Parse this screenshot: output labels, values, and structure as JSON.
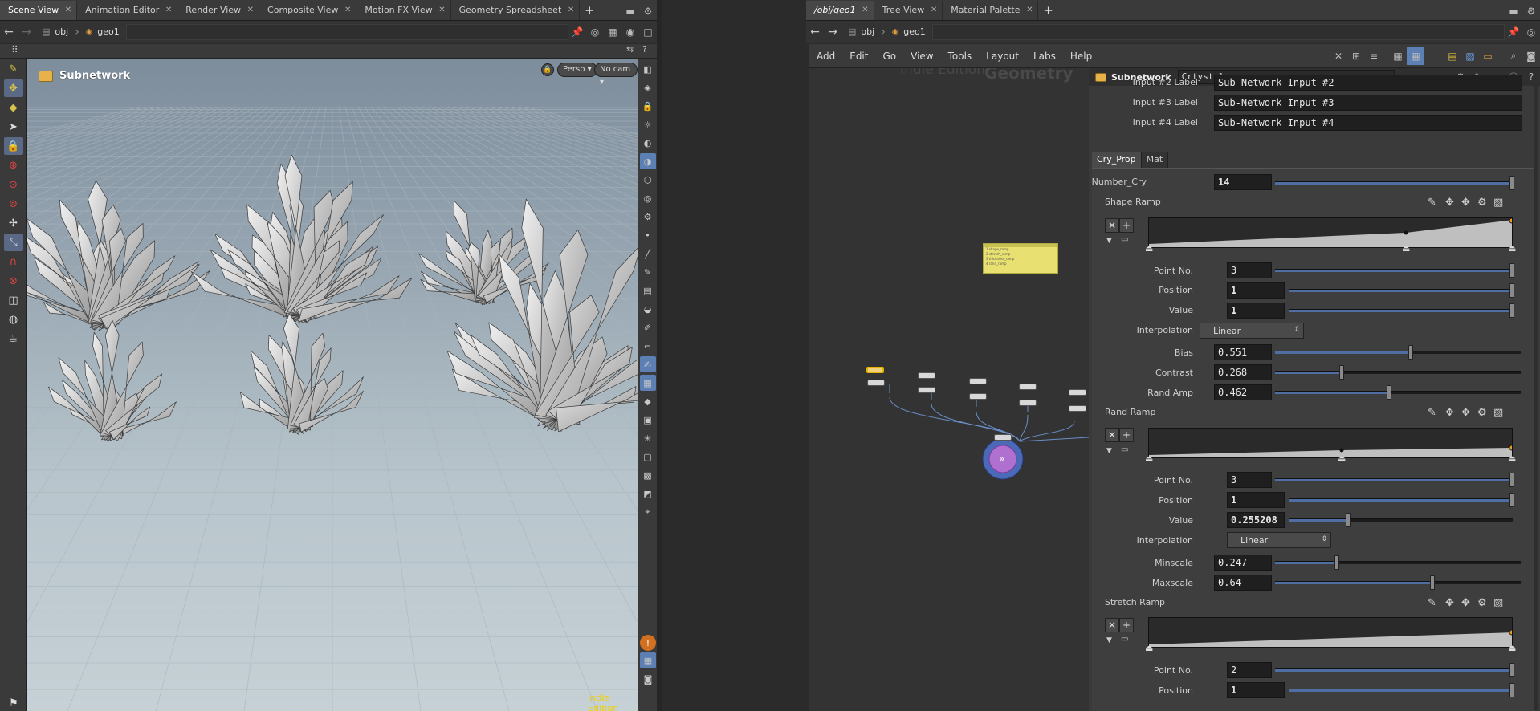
{
  "left_tabs": [
    {
      "label": "Scene View"
    },
    {
      "label": "Animation Editor"
    },
    {
      "label": "Render View"
    },
    {
      "label": "Composite View"
    },
    {
      "label": "Motion FX View"
    },
    {
      "label": "Geometry Spreadsheet"
    }
  ],
  "right_tabs": [
    {
      "label": "/obj/geo1"
    },
    {
      "label": "Tree View"
    },
    {
      "label": "Material Palette"
    }
  ],
  "left_path": {
    "obj": "obj",
    "geo": "geo1"
  },
  "right_path": {
    "obj": "obj",
    "geo": "geo1"
  },
  "viewport": {
    "title": "Subnetwork",
    "persp_label": "Persp",
    "cam_label": "No cam",
    "watermark": "Indie Edition"
  },
  "menu": [
    "Add",
    "Edit",
    "Go",
    "View",
    "Tools",
    "Layout",
    "Labs",
    "Help"
  ],
  "network": {
    "watermark_edition": "Indie Edition",
    "watermark_context": "Geometry",
    "sticky_note_lines": [
      "1 shape_ramp",
      "2 stretch_ramp",
      "3 thickness_ramp",
      "4 rand_ramp"
    ]
  },
  "params": {
    "node_type": "Subnetwork",
    "node_name": "Crtystel",
    "input_labels": [
      {
        "label": "Input #2 Label",
        "value": "Sub-Network Input #2"
      },
      {
        "label": "Input #3 Label",
        "value": "Sub-Network Input #3"
      },
      {
        "label": "Input #4 Label",
        "value": "Sub-Network Input #4"
      }
    ],
    "tabs": [
      {
        "label": "Cry_Prop"
      },
      {
        "label": "Mat"
      }
    ],
    "number_cry": {
      "label": "Number_Cry",
      "value": "14"
    },
    "shape_ramp": {
      "label": "Shape Ramp",
      "point_no": {
        "label": "Point No.",
        "value": "3"
      },
      "position": {
        "label": "Position",
        "value": "1"
      },
      "value": {
        "label": "Value",
        "value": "1"
      },
      "interpolation": {
        "label": "Interpolation",
        "value": "Linear"
      },
      "bias": {
        "label": "Bias",
        "value": "0.551"
      },
      "contrast": {
        "label": "Contrast",
        "value": "0.268"
      },
      "rand_amp": {
        "label": "Rand Amp",
        "value": "0.462"
      }
    },
    "rand_ramp": {
      "label": "Rand Ramp",
      "point_no": {
        "label": "Point No.",
        "value": "3"
      },
      "position": {
        "label": "Position",
        "value": "1"
      },
      "value": {
        "label": "Value",
        "value": "0.255208"
      },
      "interpolation": {
        "label": "Interpolation",
        "value": "Linear"
      },
      "minscale": {
        "label": "Minscale",
        "value": "0.247"
      },
      "maxscale": {
        "label": "Maxscale",
        "value": "0.64"
      }
    },
    "stretch_ramp": {
      "label": "Stretch Ramp",
      "point_no": {
        "label": "Point No.",
        "value": "2"
      },
      "position": {
        "label": "Position",
        "value": "1"
      }
    }
  },
  "colors": {
    "accent": "#4f6fa4",
    "selected_tool": "#5c7fb4",
    "node_highlight": "#e6b400",
    "watermark": "#f0d000"
  }
}
